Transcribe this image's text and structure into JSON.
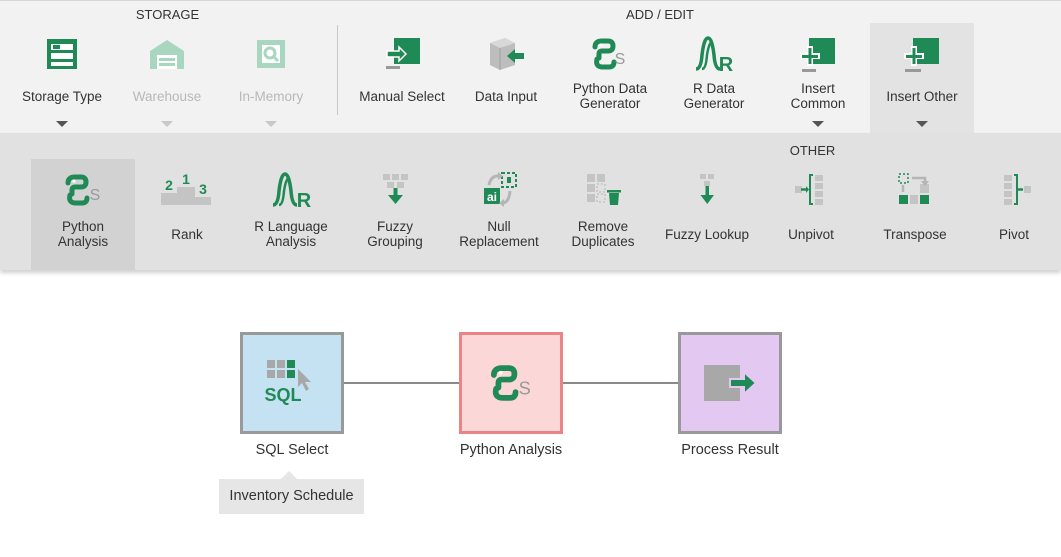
{
  "ribbon": {
    "groups": {
      "storage": "STORAGE",
      "add_edit": "ADD / EDIT"
    },
    "buttons": {
      "storage_type": "Storage Type",
      "warehouse": "Warehouse",
      "in_memory": "In-Memory",
      "manual_select": "Manual Select",
      "data_input": "Data Input",
      "python_data_generator": [
        "Python Data",
        "Generator"
      ],
      "r_data_generator": [
        "R Data",
        "Generator"
      ],
      "insert_common": [
        "Insert",
        "Common"
      ],
      "insert_other": "Insert Other"
    }
  },
  "submenu": {
    "title": "OTHER",
    "items": {
      "python_analysis": [
        "Python",
        "Analysis"
      ],
      "rank": "Rank",
      "r_language_analysis": [
        "R Language",
        "Analysis"
      ],
      "fuzzy_grouping": [
        "Fuzzy",
        "Grouping"
      ],
      "null_replacement": [
        "Null",
        "Replacement"
      ],
      "remove_duplicates": [
        "Remove",
        "Duplicates"
      ],
      "fuzzy_lookup": "Fuzzy Lookup",
      "unpivot": "Unpivot",
      "transpose": "Transpose",
      "pivot": "Pivot"
    }
  },
  "canvas": {
    "nodes": {
      "sql_select": "SQL Select",
      "python_analysis": "Python Analysis",
      "process_result": "Process Result"
    },
    "sql_icon_text": "SQL",
    "tooltip": "Inventory Schedule"
  },
  "icon_glyphs": {
    "rank_1": "1",
    "rank_2": "2",
    "rank_3": "3",
    "r_letter": "R",
    "null_ai": "ai",
    "python_letter": "S"
  },
  "colors": {
    "accent_green": "#1f8a55",
    "light_green": "#9fd4b6",
    "sql_node_bg": "#c5e2f2",
    "python_node_bg": "#fbd7d8",
    "python_node_border": "#ea8486",
    "process_node_bg": "#e3c9f1"
  }
}
